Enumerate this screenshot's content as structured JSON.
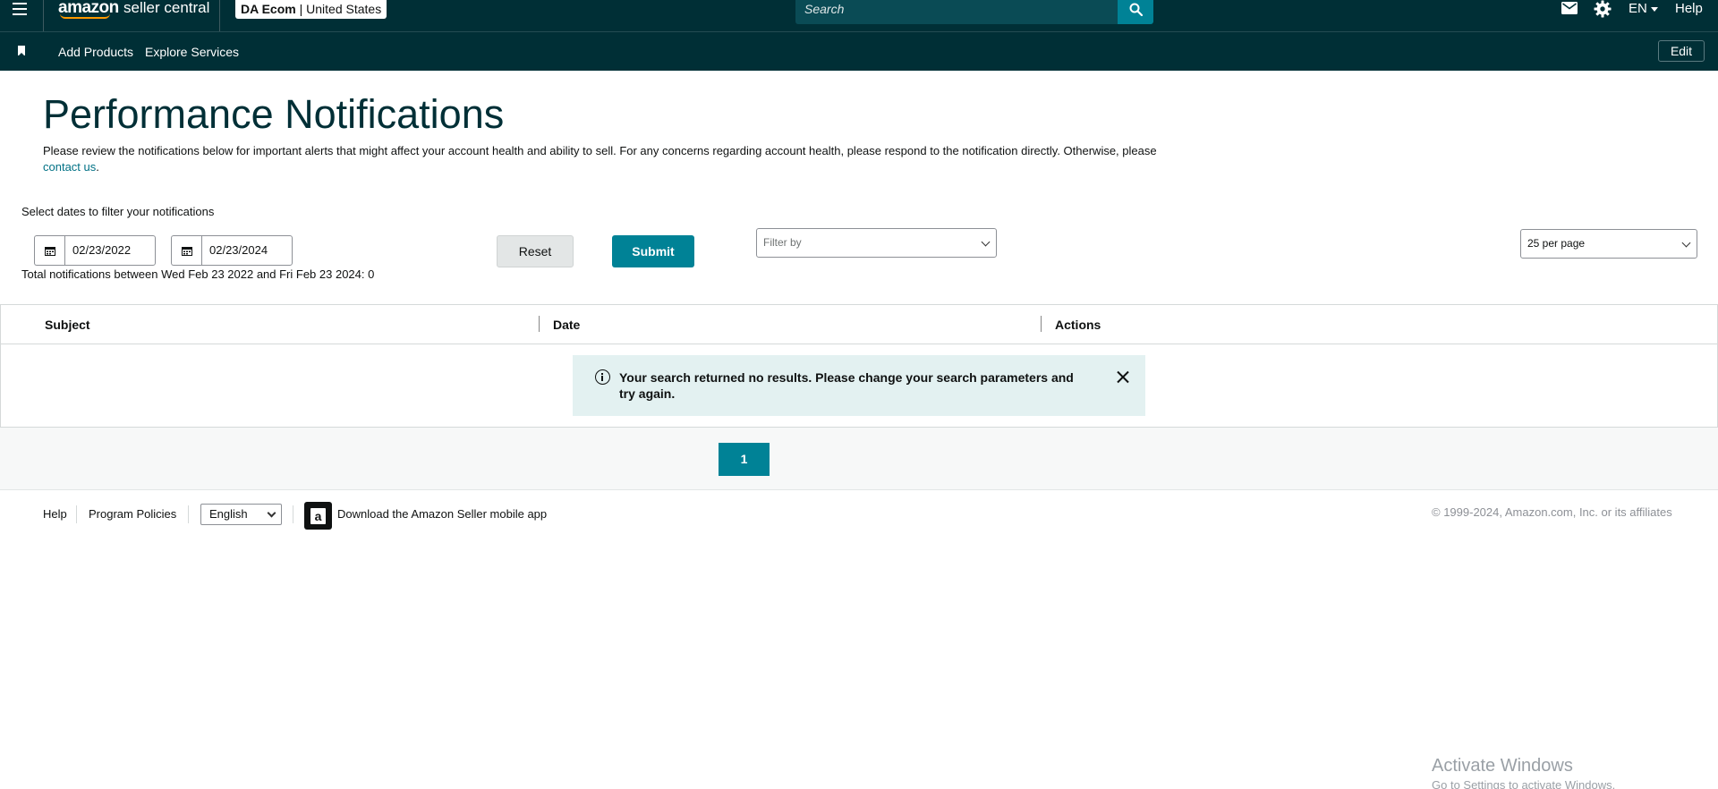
{
  "topbar": {
    "logo_brand": "amazon",
    "logo_product": "seller central",
    "account_name": "DA Ecom",
    "account_separator": "|",
    "account_region": "United States",
    "search_placeholder": "Search",
    "language": "EN",
    "help": "Help"
  },
  "navbar": {
    "items": [
      {
        "label": "Add Products"
      },
      {
        "label": "Explore Services"
      }
    ],
    "edit_label": "Edit"
  },
  "page": {
    "title": "Performance Notifications",
    "description": "Please review the notifications below for important alerts that might affect your account health and ability to sell. For any concerns regarding account health, please respond to the notification directly. Otherwise, please",
    "contact_link": "contact us",
    "description_end": "."
  },
  "filters": {
    "label": "Select dates to filter your notifications",
    "start_date": "02/23/2022",
    "end_date": "02/23/2024",
    "reset_label": "Reset",
    "submit_label": "Submit",
    "filter_by_placeholder": "Filter by",
    "per_page": "25 per page",
    "total_text": "Total notifications between Wed Feb 23 2022 and Fri Feb 23 2024: 0"
  },
  "table": {
    "columns": [
      "Subject",
      "Date",
      "Actions"
    ],
    "empty_message": "Your search returned no results. Please change your search parameters and try again."
  },
  "pagination": {
    "current_page": "1"
  },
  "footer": {
    "help": "Help",
    "program_policies": "Program Policies",
    "language_selected": "English",
    "download_app": "Download the Amazon Seller mobile app",
    "copyright": "© 1999-2024, Amazon.com, Inc. or its affiliates"
  },
  "os_overlay": {
    "activate_title": "Activate Windows",
    "activate_sub": "Go to Settings to activate Windows."
  },
  "colors": {
    "header_bg": "#002f36",
    "accent": "#008296",
    "title": "#002f36",
    "link": "#007185",
    "alert_bg": "#e3f1f1"
  },
  "icons": {
    "menu": "hamburger-menu-icon",
    "search": "search-icon",
    "mail": "mail-icon",
    "settings": "gear-icon",
    "bookmark": "bookmark-icon",
    "calendar": "calendar-icon",
    "info": "info-icon",
    "close": "close-icon",
    "app": "amazon-app-icon"
  }
}
